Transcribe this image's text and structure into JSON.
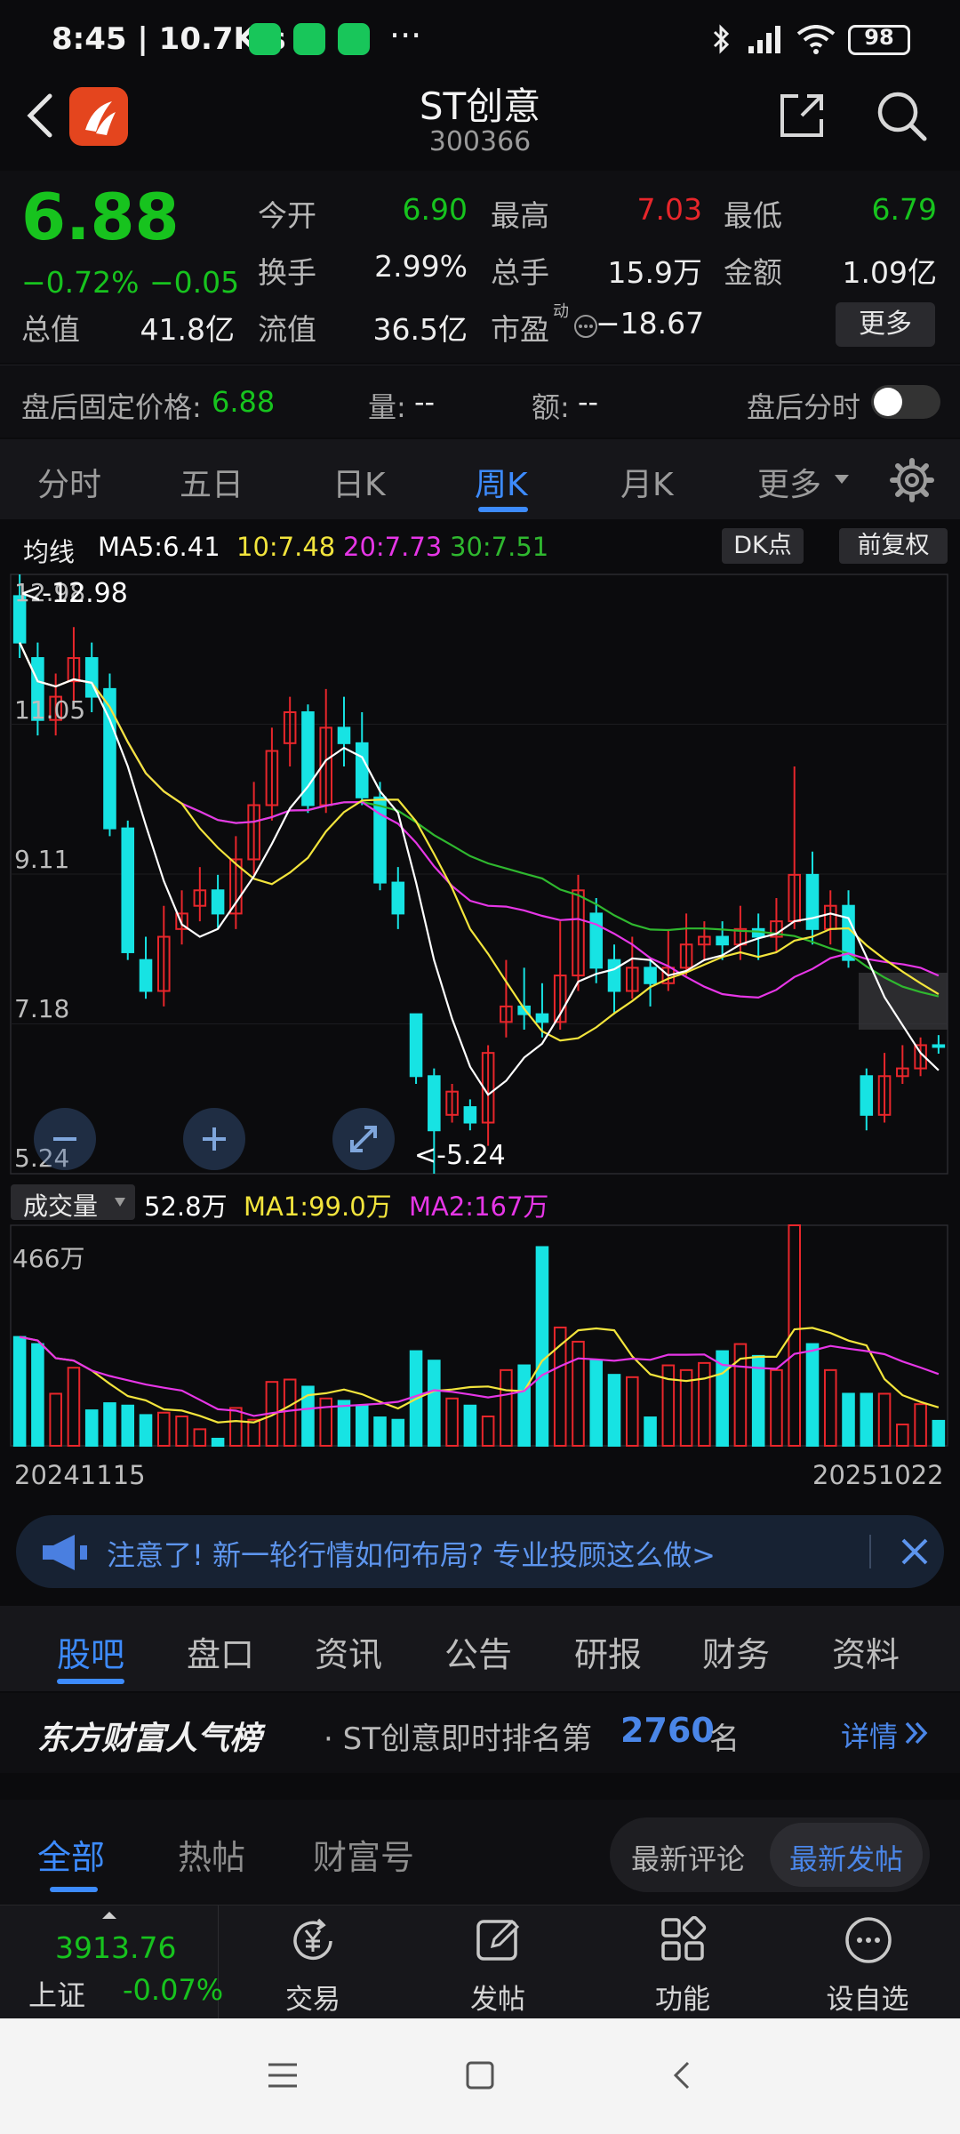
{
  "status_bar": {
    "time": "8:45 | 10.7K/s",
    "dots": "···",
    "battery": "98"
  },
  "header": {
    "name": "ST创意",
    "code": "300366"
  },
  "quote": {
    "price": "6.88",
    "change_pct": "−0.72%",
    "change": "−0.05",
    "open_label": "今开",
    "open": "6.90",
    "high_label": "最高",
    "high": "7.03",
    "low_label": "最低",
    "low": "6.79",
    "turnover_label": "换手",
    "turnover": "2.99%",
    "volume_label": "总手",
    "volume": "15.9万",
    "amount_label": "金额",
    "amount": "1.09亿",
    "mktcap_label": "总值",
    "mktcap": "41.8亿",
    "float_label": "流值",
    "float": "36.5亿",
    "pe_label": "市盈",
    "pe_sup": "动",
    "pe": "−18.67",
    "more_button": "更多"
  },
  "after_hours": {
    "label": "盘后固定价格:",
    "price": "6.88",
    "vol_label": "量:",
    "vol": "--",
    "amt_label": "额:",
    "amt": "--",
    "intraday_label": "盘后分时"
  },
  "period_tabs": [
    "分时",
    "五日",
    "日K",
    "周K",
    "月K",
    "更多"
  ],
  "active_period": "周K",
  "ma_legend": {
    "label": "均线",
    "ma5": "MA5:6.41",
    "ma10": "10:7.48",
    "ma20": "20:7.73",
    "ma30": "30:7.51",
    "dk_button": "DK点",
    "adjust_button": "前复权"
  },
  "price_axis": {
    "labels": [
      "12.98",
      "11.05",
      "9.11",
      "7.18",
      "5.24"
    ],
    "max_marker": "<-12.98",
    "min_marker": "<-5.24"
  },
  "volume_legend": {
    "selector": "成交量",
    "vol": "52.8万",
    "ma1": "MA1:99.0万",
    "ma2": "MA2:167万",
    "max_label": "466万"
  },
  "date_axis": {
    "start": "20241115",
    "end": "20251022"
  },
  "colors": {
    "up": "#e8262b",
    "down": "#17e3e3",
    "ma5": "#ffffff",
    "ma10": "#f2e43c",
    "ma20": "#e636e6",
    "ma30": "#2fb82f",
    "accent": "#3b82f6"
  },
  "chart_data": {
    "type": "candlestick",
    "period": "weekly",
    "y_price_range": [
      5.24,
      12.98
    ],
    "y_volume_max": 4660000,
    "candles": [
      {
        "o": 12.7,
        "c": 12.1,
        "h": 12.98,
        "l": 11.9,
        "v": 230
      },
      {
        "o": 11.9,
        "c": 11.1,
        "h": 12.1,
        "l": 10.9,
        "v": 215
      },
      {
        "o": 11.1,
        "c": 11.4,
        "h": 11.7,
        "l": 10.9,
        "v": 110
      },
      {
        "o": 11.6,
        "c": 11.9,
        "h": 12.3,
        "l": 11.3,
        "v": 165
      },
      {
        "o": 11.9,
        "c": 11.4,
        "h": 12.1,
        "l": 11.2,
        "v": 75
      },
      {
        "o": 11.5,
        "c": 9.7,
        "h": 11.7,
        "l": 9.6,
        "v": 90
      },
      {
        "o": 9.7,
        "c": 8.1,
        "h": 9.8,
        "l": 8.0,
        "v": 85
      },
      {
        "o": 8.0,
        "c": 7.6,
        "h": 8.3,
        "l": 7.5,
        "v": 65
      },
      {
        "o": 7.6,
        "c": 8.3,
        "h": 8.7,
        "l": 7.4,
        "v": 70
      },
      {
        "o": 8.4,
        "c": 8.6,
        "h": 8.9,
        "l": 8.2,
        "v": 62
      },
      {
        "o": 8.7,
        "c": 8.9,
        "h": 9.2,
        "l": 8.5,
        "v": 35
      },
      {
        "o": 8.9,
        "c": 8.6,
        "h": 9.1,
        "l": 8.4,
        "v": 15
      },
      {
        "o": 8.6,
        "c": 9.3,
        "h": 9.6,
        "l": 8.4,
        "v": 80
      },
      {
        "o": 9.3,
        "c": 10.0,
        "h": 10.3,
        "l": 9.1,
        "v": 55
      },
      {
        "o": 10.0,
        "c": 10.7,
        "h": 11.0,
        "l": 9.8,
        "v": 135
      },
      {
        "o": 10.8,
        "c": 11.2,
        "h": 11.4,
        "l": 10.5,
        "v": 140
      },
      {
        "o": 11.2,
        "c": 10.0,
        "h": 11.3,
        "l": 9.9,
        "v": 125
      },
      {
        "o": 10.0,
        "c": 11.0,
        "h": 11.5,
        "l": 9.9,
        "v": 100
      },
      {
        "o": 11.0,
        "c": 10.8,
        "h": 11.4,
        "l": 10.5,
        "v": 95
      },
      {
        "o": 10.8,
        "c": 10.1,
        "h": 11.2,
        "l": 10.0,
        "v": 85
      },
      {
        "o": 10.1,
        "c": 9.0,
        "h": 10.3,
        "l": 8.9,
        "v": 60
      },
      {
        "o": 9.0,
        "c": 8.6,
        "h": 9.2,
        "l": 8.4,
        "v": 55
      },
      {
        "o": 7.3,
        "c": 6.5,
        "h": 7.3,
        "l": 6.4,
        "v": 200
      },
      {
        "o": 6.5,
        "c": 5.8,
        "h": 6.6,
        "l": 5.24,
        "v": 180
      },
      {
        "o": 6.0,
        "c": 6.3,
        "h": 6.4,
        "l": 5.9,
        "v": 100
      },
      {
        "o": 6.1,
        "c": 5.9,
        "h": 6.2,
        "l": 5.8,
        "v": 85
      },
      {
        "o": 5.9,
        "c": 6.8,
        "h": 6.9,
        "l": 5.6,
        "v": 62
      },
      {
        "o": 7.2,
        "c": 7.4,
        "h": 8.0,
        "l": 7.0,
        "v": 160
      },
      {
        "o": 7.4,
        "c": 7.3,
        "h": 7.9,
        "l": 7.1,
        "v": 170
      },
      {
        "o": 7.3,
        "c": 7.2,
        "h": 7.7,
        "l": 7.0,
        "v": 420
      },
      {
        "o": 7.2,
        "c": 7.8,
        "h": 8.5,
        "l": 7.1,
        "v": 250
      },
      {
        "o": 7.8,
        "c": 8.9,
        "h": 9.1,
        "l": 7.6,
        "v": 220
      },
      {
        "o": 8.6,
        "c": 7.9,
        "h": 8.8,
        "l": 7.7,
        "v": 180
      },
      {
        "o": 8.0,
        "c": 7.6,
        "h": 8.2,
        "l": 7.3,
        "v": 150
      },
      {
        "o": 7.6,
        "c": 7.9,
        "h": 8.3,
        "l": 7.5,
        "v": 145
      },
      {
        "o": 7.9,
        "c": 7.7,
        "h": 8.0,
        "l": 7.4,
        "v": 60
      },
      {
        "o": 7.7,
        "c": 7.9,
        "h": 8.4,
        "l": 7.6,
        "v": 170
      },
      {
        "o": 7.9,
        "c": 8.2,
        "h": 8.6,
        "l": 7.8,
        "v": 160
      },
      {
        "o": 8.2,
        "c": 8.3,
        "h": 8.5,
        "l": 8.0,
        "v": 175
      },
      {
        "o": 8.3,
        "c": 8.2,
        "h": 8.5,
        "l": 8.0,
        "v": 200
      },
      {
        "o": 8.2,
        "c": 8.4,
        "h": 8.7,
        "l": 8.0,
        "v": 215
      },
      {
        "o": 8.4,
        "c": 8.3,
        "h": 8.6,
        "l": 8.0,
        "v": 190
      },
      {
        "o": 8.3,
        "c": 8.5,
        "h": 8.8,
        "l": 8.1,
        "v": 160
      },
      {
        "o": 8.5,
        "c": 9.1,
        "h": 10.5,
        "l": 8.4,
        "v": 466
      },
      {
        "o": 9.1,
        "c": 8.4,
        "h": 9.4,
        "l": 8.2,
        "v": 215
      },
      {
        "o": 8.4,
        "c": 8.7,
        "h": 8.9,
        "l": 8.2,
        "v": 160
      },
      {
        "o": 8.7,
        "c": 8.0,
        "h": 8.9,
        "l": 7.9,
        "v": 110
      },
      {
        "o": 6.5,
        "c": 6.0,
        "h": 6.6,
        "l": 5.8,
        "v": 110
      },
      {
        "o": 6.0,
        "c": 6.5,
        "h": 6.8,
        "l": 5.9,
        "v": 110
      },
      {
        "o": 6.5,
        "c": 6.6,
        "h": 6.9,
        "l": 6.4,
        "v": 45
      },
      {
        "o": 6.6,
        "c": 6.9,
        "h": 7.0,
        "l": 6.5,
        "v": 88
      },
      {
        "o": 6.9,
        "c": 6.88,
        "h": 7.03,
        "l": 6.79,
        "v": 52.8
      }
    ]
  },
  "banner": {
    "text": "注意了! 新一轮行情如何布局? 专业投顾这么做>"
  },
  "sub_tabs": [
    "股吧",
    "盘口",
    "资讯",
    "公告",
    "研报",
    "财务",
    "资料"
  ],
  "active_sub_tab": "股吧",
  "rank": {
    "brand": "东方财富人气榜",
    "text": "· ST创意即时排名第",
    "num": "2760",
    "suffix": "名",
    "detail": "详情"
  },
  "feed_filters": {
    "tabs": [
      "全部",
      "热帖",
      "财富号"
    ],
    "active": "全部",
    "sort": [
      "最新评论",
      "最新发帖"
    ],
    "active_sort": "最新发帖"
  },
  "bottom_nav": {
    "index_value": "3913.76",
    "index_name": "上证",
    "index_change": "-0.07%",
    "items": [
      "交易",
      "发帖",
      "功能",
      "设自选"
    ]
  }
}
